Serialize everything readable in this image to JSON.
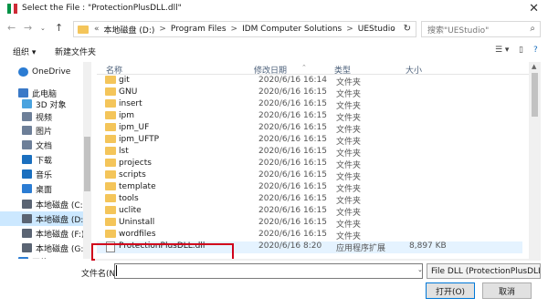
{
  "window": {
    "title": "Select the File : \"ProtectionPlusDLL.dll\""
  },
  "address": {
    "segments": [
      "本地磁盘 (D:)",
      "Program Files",
      "IDM Computer Solutions",
      "UEStudio"
    ],
    "prefix": "«",
    "separator": ">"
  },
  "search": {
    "placeholder": "搜索\"UEStudio\""
  },
  "toolbar": {
    "organize": "组织 ▾",
    "new_folder": "新建文件夹"
  },
  "nav": {
    "items": [
      {
        "label": "OneDrive",
        "icon": "cloud-icon",
        "color": "#2b7cd3"
      },
      {
        "label": "此电脑",
        "icon": "computer-icon",
        "color": "#3a79c7"
      },
      {
        "label": "3D 对象",
        "icon": "cube-icon",
        "color": "#4aa3df"
      },
      {
        "label": "视频",
        "icon": "video-icon",
        "color": "#6d7f98"
      },
      {
        "label": "图片",
        "icon": "picture-icon",
        "color": "#6d7f98"
      },
      {
        "label": "文档",
        "icon": "document-icon",
        "color": "#6d7f98"
      },
      {
        "label": "下载",
        "icon": "download-icon",
        "color": "#1a6fbf"
      },
      {
        "label": "音乐",
        "icon": "music-icon",
        "color": "#1a6fbf"
      },
      {
        "label": "桌面",
        "icon": "desktop-icon",
        "color": "#2b7cd3"
      },
      {
        "label": "本地磁盘 (C:)",
        "icon": "drive-icon",
        "color": "#5a6473"
      },
      {
        "label": "本地磁盘 (D:)",
        "icon": "drive-icon",
        "color": "#5a6473",
        "selected": true
      },
      {
        "label": "本地磁盘 (F:)",
        "icon": "drive-icon",
        "color": "#5a6473"
      },
      {
        "label": "本地磁盘 (G:)",
        "icon": "drive-icon",
        "color": "#5a6473"
      },
      {
        "label": "网络",
        "icon": "network-icon",
        "color": "#2b7cd3"
      }
    ]
  },
  "columns": {
    "name": "名称",
    "date": "修改日期",
    "type": "类型",
    "size": "大小"
  },
  "files": [
    {
      "name": "git",
      "date": "2020/6/16 16:14",
      "type": "文件夹",
      "size": "",
      "kind": "folder"
    },
    {
      "name": "GNU",
      "date": "2020/6/16 16:15",
      "type": "文件夹",
      "size": "",
      "kind": "folder"
    },
    {
      "name": "insert",
      "date": "2020/6/16 16:15",
      "type": "文件夹",
      "size": "",
      "kind": "folder"
    },
    {
      "name": "ipm",
      "date": "2020/6/16 16:15",
      "type": "文件夹",
      "size": "",
      "kind": "folder"
    },
    {
      "name": "ipm_UF",
      "date": "2020/6/16 16:15",
      "type": "文件夹",
      "size": "",
      "kind": "folder"
    },
    {
      "name": "ipm_UFTP",
      "date": "2020/6/16 16:15",
      "type": "文件夹",
      "size": "",
      "kind": "folder"
    },
    {
      "name": "lst",
      "date": "2020/6/16 16:15",
      "type": "文件夹",
      "size": "",
      "kind": "folder"
    },
    {
      "name": "projects",
      "date": "2020/6/16 16:15",
      "type": "文件夹",
      "size": "",
      "kind": "folder"
    },
    {
      "name": "scripts",
      "date": "2020/6/16 16:15",
      "type": "文件夹",
      "size": "",
      "kind": "folder"
    },
    {
      "name": "template",
      "date": "2020/6/16 16:15",
      "type": "文件夹",
      "size": "",
      "kind": "folder"
    },
    {
      "name": "tools",
      "date": "2020/6/16 16:15",
      "type": "文件夹",
      "size": "",
      "kind": "folder"
    },
    {
      "name": "uclite",
      "date": "2020/6/16 16:15",
      "type": "文件夹",
      "size": "",
      "kind": "folder"
    },
    {
      "name": "Uninstall",
      "date": "2020/6/16 16:15",
      "type": "文件夹",
      "size": "",
      "kind": "folder"
    },
    {
      "name": "wordfiles",
      "date": "2020/6/16 16:15",
      "type": "文件夹",
      "size": "",
      "kind": "folder"
    },
    {
      "name": "ProtectionPlusDLL.dll",
      "date": "2020/6/16 8:20",
      "type": "应用程序扩展",
      "size": "8,897 KB",
      "kind": "dll"
    }
  ],
  "bottom": {
    "filename_label": "文件名(N):",
    "filename_value": "",
    "filetype": "File DLL (ProtectionPlusDLL.dll)",
    "open": "打开(O)",
    "cancel": "取消"
  },
  "colors": {
    "folder": "#f4c55a",
    "highlight": "#d0021b",
    "selection": "#cce8ff"
  }
}
